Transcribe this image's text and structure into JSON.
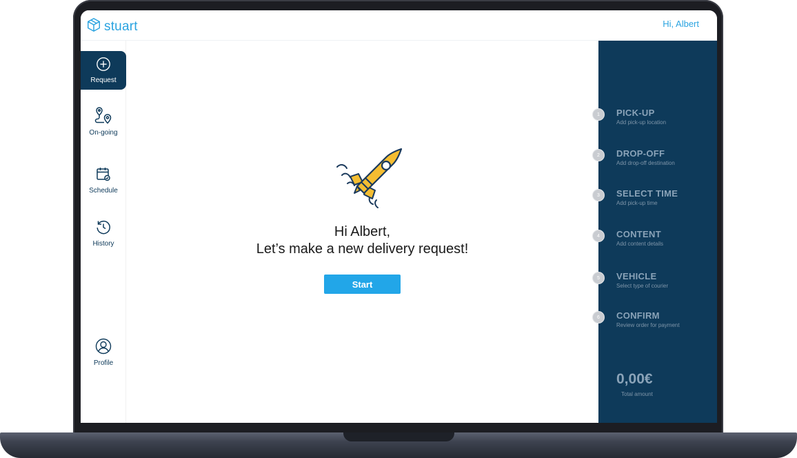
{
  "app": {
    "logo_text": "stuart",
    "greeting": "Hi, Albert",
    "brand_color": "#2aa3e0",
    "panel_color": "#0e3a5a"
  },
  "sidebar": {
    "items": [
      {
        "label": "Request",
        "icon": "plus-circle-icon",
        "active": true
      },
      {
        "label": "On-going",
        "icon": "route-icon",
        "active": false
      },
      {
        "label": "Schedule",
        "icon": "calendar-icon",
        "active": false
      },
      {
        "label": "History",
        "icon": "history-icon",
        "active": false
      },
      {
        "label": "Profile",
        "icon": "user-icon",
        "active": false
      }
    ]
  },
  "main": {
    "illustration": "rocket-icon",
    "headline_line1": "Hi Albert,",
    "headline_line2": "Let’s make a new delivery request!",
    "start_label": "Start"
  },
  "steps": [
    {
      "number": "1",
      "title": "PICK-UP",
      "subtitle": "Add pick-up location"
    },
    {
      "number": "2",
      "title": "DROP-OFF",
      "subtitle": "Add drop-off destination"
    },
    {
      "number": "3",
      "title": "SELECT TIME",
      "subtitle": "Add pick-up time"
    },
    {
      "number": "4",
      "title": "CONTENT",
      "subtitle": "Add content details"
    },
    {
      "number": "5",
      "title": "VEHICLE",
      "subtitle": "Select type of courier"
    },
    {
      "number": "6",
      "title": "CONFIRM",
      "subtitle": "Review order for payment"
    }
  ],
  "total": {
    "amount": "0,00€",
    "label": "Total amount"
  }
}
